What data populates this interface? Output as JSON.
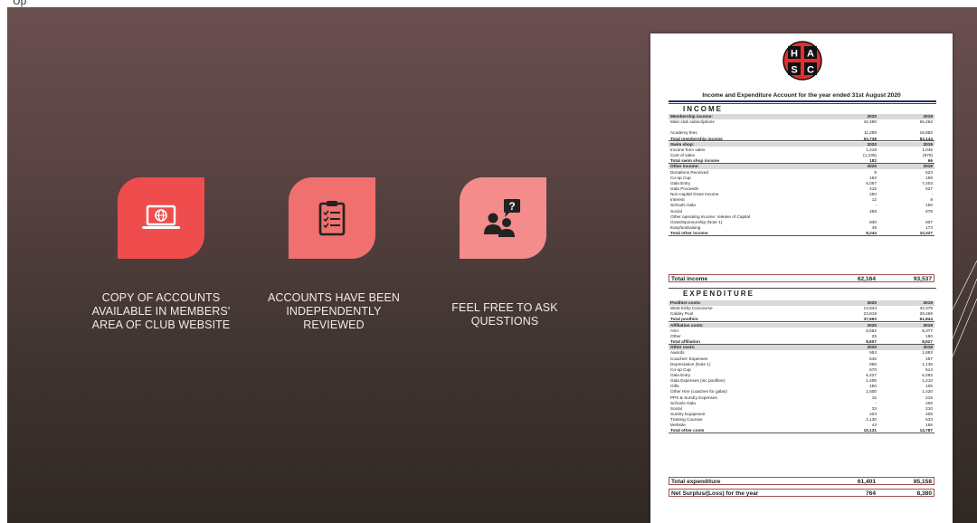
{
  "top_text": "Up",
  "tiles": [
    {
      "icon": "laptop-globe-icon",
      "color": "#ef4d4d",
      "caption": [
        "COPY OF ACCOUNTS",
        "AVAILABLE IN MEMBERS'",
        "AREA OF CLUB WEBSITE"
      ]
    },
    {
      "icon": "clipboard-checklist-icon",
      "color": "#f06f6f",
      "caption": [
        "ACCOUNTS HAVE BEEN",
        "INDEPENDENTLY",
        "REVIEWED"
      ]
    },
    {
      "icon": "people-question-icon",
      "color": "#f48c8c",
      "caption": [
        "FEEL FREE TO ASK",
        "QUESTIONS"
      ]
    }
  ],
  "statement": {
    "logo_letters": [
      "H",
      "A",
      "S",
      "C"
    ],
    "title": "Income and Expenditure Account for the year ended 31st August 2020",
    "income_heading": "INCOME",
    "expenditure_heading": "EXPENDITURE",
    "income_rows": [
      {
        "l": "Membership income:",
        "a": "2020",
        "b": "2019",
        "k": "head"
      },
      {
        "l": "Main club subscriptions",
        "a": "42,480",
        "b": "66,262"
      },
      {
        "l": "",
        "a": "",
        "b": ""
      },
      {
        "l": "Academy fees",
        "a": "11,259",
        "b": "16,882"
      },
      {
        "l": "Total membership income",
        "a": "53,738",
        "b": "83,144",
        "k": "total"
      },
      {
        "l": "Swim shop:",
        "a": "2020",
        "b": "2019",
        "k": "head"
      },
      {
        "l": "Income from sales",
        "a": "1,418",
        "b": "1,045"
      },
      {
        "l": "Cost of sales",
        "a": "(1,235)",
        "b": "(979)"
      },
      {
        "l": "Total swim shop income",
        "a": "182",
        "b": "66",
        "k": "total"
      },
      {
        "l": "Other income:",
        "a": "2020",
        "b": "2019",
        "k": "head"
      },
      {
        "l": "Donations Received",
        "a": "9",
        "b": "523"
      },
      {
        "l": "Co-op Cup",
        "a": "163",
        "b": "159"
      },
      {
        "l": "Gala Entry",
        "a": "6,057",
        "b": "7,403"
      },
      {
        "l": "Gala Proceeds",
        "a": "415",
        "b": "527"
      },
      {
        "l": "Non-capital Grant Income",
        "a": "250",
        "b": "-"
      },
      {
        "l": "Interest",
        "a": "12",
        "b": "8"
      },
      {
        "l": "Schools Gala",
        "a": "-",
        "b": "150"
      },
      {
        "l": "Social",
        "a": "459",
        "b": "578"
      },
      {
        "l": "Other operating income: release of Capital",
        "a": "",
        "b": ""
      },
      {
        "l": "Grant/Sponsorship (Note 1)",
        "a": "830",
        "b": "807"
      },
      {
        "l": "Easyfundraising",
        "a": "49",
        "b": "173"
      },
      {
        "l": "Total other income",
        "a": "8,244",
        "b": "10,327",
        "k": "total"
      }
    ],
    "total_income": {
      "l": "Total income",
      "a": "62,164",
      "b": "93,537"
    },
    "expenditure_rows": [
      {
        "l": "Poolhire costs:",
        "a": "2020",
        "b": "2019",
        "k": "head"
      },
      {
        "l": "West Kirby Concourse",
        "a": "13,844",
        "b": "32,375"
      },
      {
        "l": "Caldey Pool",
        "a": "23,819",
        "b": "29,469"
      },
      {
        "l": "Total poolhire",
        "a": "37,663",
        "b": "61,844",
        "k": "total"
      },
      {
        "l": "Affiliation costs:",
        "a": "2020",
        "b": "2019",
        "k": "head"
      },
      {
        "l": "ASA",
        "a": "8,582",
        "b": "8,377"
      },
      {
        "l": "Other",
        "a": "25",
        "b": "150"
      },
      {
        "l": "Total affiliation",
        "a": "8,607",
        "b": "8,527",
        "k": "total"
      },
      {
        "l": "Other costs:",
        "a": "2020",
        "b": "2019",
        "k": "head"
      },
      {
        "l": "Awards",
        "a": "953",
        "b": "1,893"
      },
      {
        "l": "Coaches' Expenses",
        "a": "545",
        "b": "457"
      },
      {
        "l": "Depreciation (Note 1)",
        "a": "856",
        "b": "1,136"
      },
      {
        "l": "Co-op Cup",
        "a": "670",
        "b": "514"
      },
      {
        "l": "Gala Entry",
        "a": "6,427",
        "b": "6,282"
      },
      {
        "l": "Gala Expenses (inc poolhire)",
        "a": "1,406",
        "b": "1,210"
      },
      {
        "l": "Gifts",
        "a": "150",
        "b": "105"
      },
      {
        "l": "Other Hire (coaches for galas)",
        "a": "1,500",
        "b": "1,420"
      },
      {
        "l": "PPS & Sundry Expenses",
        "a": "16",
        "b": "215"
      },
      {
        "l": "Schools Gala",
        "a": "-",
        "b": "200"
      },
      {
        "l": "Social",
        "a": "33",
        "b": "210"
      },
      {
        "l": "Sundry Equipment",
        "a": "403",
        "b": "408"
      },
      {
        "l": "Training Courses",
        "a": "2,130",
        "b": "533"
      },
      {
        "l": "Website",
        "a": "43",
        "b": "156"
      },
      {
        "l": "Total other costs",
        "a": "15,131",
        "b": "14,787",
        "k": "total"
      }
    ],
    "total_expenditure": {
      "l": "Total expenditure",
      "a": "61,401",
      "b": "85,158"
    },
    "net": {
      "l": "Net Surplus/(Loss) for the year",
      "a": "764",
      "b": "8,380"
    }
  }
}
